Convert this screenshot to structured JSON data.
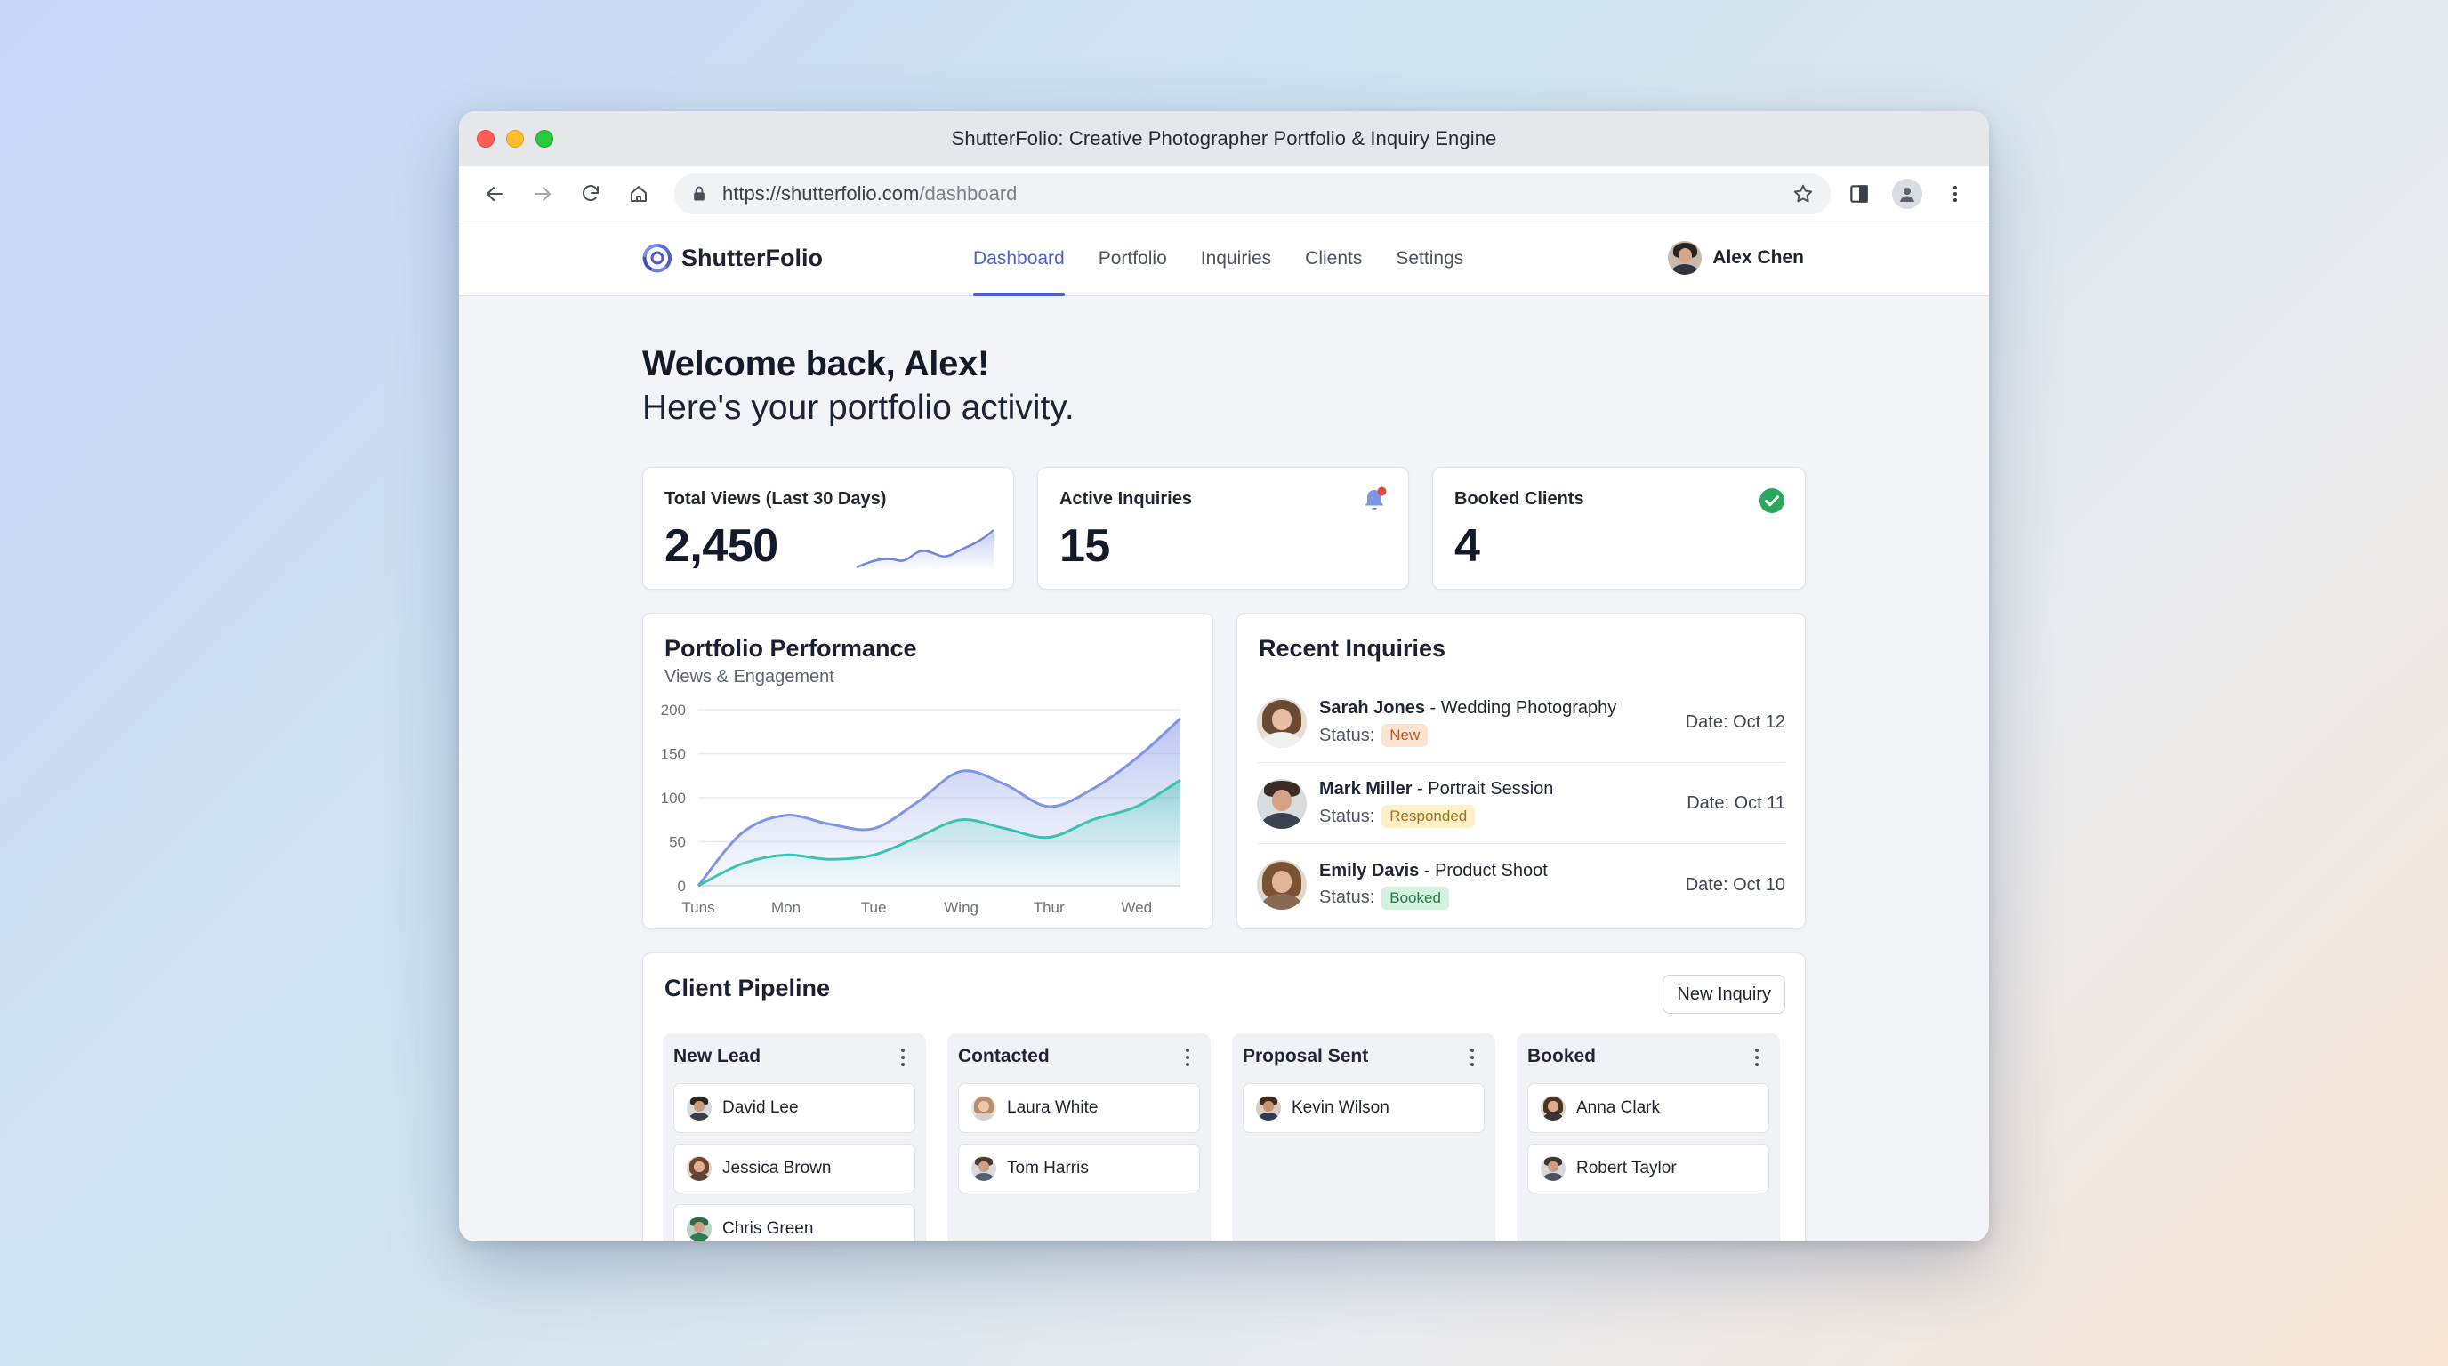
{
  "window": {
    "title": "ShutterFolio: Creative Photographer Portfolio & Inquiry Engine"
  },
  "browser": {
    "url_host": "https://shutterfolio.com",
    "url_path": "/dashboard"
  },
  "app": {
    "brand": "ShutterFolio",
    "nav": [
      "Dashboard",
      "Portfolio",
      "Inquiries",
      "Clients",
      "Settings"
    ],
    "active_nav": "Dashboard",
    "user_name": "Alex Chen"
  },
  "welcome": {
    "heading": "Welcome back, Alex!",
    "subheading": "Here's your portfolio activity."
  },
  "kpis": {
    "views_label": "Total Views (Last 30 Days)",
    "views_value": "2,450",
    "inquiries_label": "Active Inquiries",
    "inquiries_value": "15",
    "booked_label": "Booked Clients",
    "booked_value": "4"
  },
  "performance": {
    "title": "Portfolio Performance",
    "subtitle": "Views & Engagement"
  },
  "chart_data": {
    "type": "area",
    "title": "Portfolio Performance",
    "subtitle": "Views & Engagement",
    "categories": [
      "Tuns",
      "Mon",
      "Tue",
      "Wing",
      "Thur",
      "Wed"
    ],
    "ylim": [
      0,
      200
    ],
    "yticks": [
      0,
      50,
      100,
      150,
      200
    ],
    "grid": true,
    "series": [
      {
        "x": [
          0,
          0.5,
          1,
          1.5,
          2,
          2.5,
          3,
          3.5,
          4,
          4.5,
          5,
          5.5
        ],
        "values": [
          0,
          60,
          80,
          70,
          65,
          95,
          130,
          115,
          90,
          110,
          145,
          190
        ],
        "color": "#7f95e6"
      },
      {
        "x": [
          0,
          0.5,
          1,
          1.5,
          2,
          2.5,
          3,
          3.5,
          4,
          4.5,
          5,
          5.5
        ],
        "values": [
          0,
          25,
          35,
          30,
          35,
          55,
          75,
          65,
          55,
          75,
          90,
          120
        ],
        "color": "#3cc2b0"
      }
    ]
  },
  "inquiries": {
    "title": "Recent Inquiries",
    "status_label": "Status:",
    "items": [
      {
        "name": "Sarah Jones",
        "service": " - Wedding Photography",
        "status": "New",
        "date": "Date: Oct 12"
      },
      {
        "name": "Mark Miller",
        "service": " - Portrait Session",
        "status": "Responded",
        "date": "Date: Oct 11"
      },
      {
        "name": "Emily Davis",
        "service": " - Product Shoot",
        "status": "Booked",
        "date": "Date: Oct 10"
      }
    ]
  },
  "pipeline": {
    "title": "Client Pipeline",
    "new_button": "New Inquiry",
    "columns": [
      {
        "title": "New Lead",
        "clients": [
          "David Lee",
          "Jessica Brown",
          "Chris Green"
        ]
      },
      {
        "title": "Contacted",
        "clients": [
          "Laura White",
          "Tom Harris"
        ]
      },
      {
        "title": "Proposal Sent",
        "clients": [
          "Kevin Wilson"
        ]
      },
      {
        "title": "Booked",
        "clients": [
          "Anna Clark",
          "Robert Taylor"
        ]
      }
    ]
  },
  "colors": {
    "accent": "#4a63c9",
    "notify_dot": "#e5483b",
    "check_green": "#2aa85a"
  },
  "icons": [
    "back-arrow-icon",
    "forward-arrow-icon",
    "reload-icon",
    "home-icon",
    "lock-icon",
    "star-icon",
    "sidebar-icon",
    "profile-icon",
    "kebab-menu-icon",
    "bell-icon",
    "check-circle-icon"
  ]
}
